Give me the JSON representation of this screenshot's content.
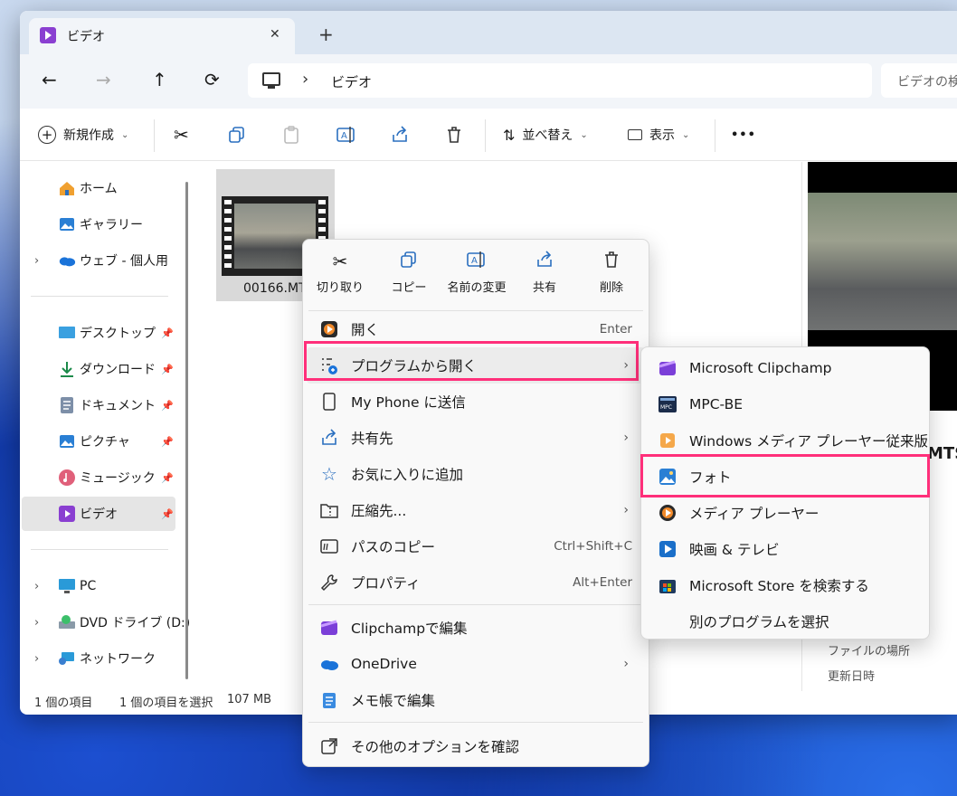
{
  "tab": {
    "title": "ビデオ",
    "close": "✕",
    "new_tab": "+"
  },
  "nav": {
    "back": "←",
    "forward": "→",
    "up": "↑",
    "refresh": "⟳",
    "chevron": "›",
    "location": "ビデオ",
    "search_placeholder": "ビデオの検"
  },
  "toolbar": {
    "new": "新規作成",
    "sort": "並べ替え",
    "view": "表示",
    "more": "•••"
  },
  "sidebar": {
    "home": "ホーム",
    "gallery": "ギャラリー",
    "web": "ウェブ - 個人用",
    "desktop": "デスクトップ",
    "downloads": "ダウンロード",
    "documents": "ドキュメント",
    "pictures": "ピクチャ",
    "music": "ミュージック",
    "videos": "ビデオ",
    "pc": "PC",
    "dvd": "DVD ドライブ (D:)",
    "network": "ネットワーク"
  },
  "file": {
    "name": "00166.MT"
  },
  "status": {
    "count": "1 個の項目",
    "selected": "1 個の項目を選択",
    "size": "107 MB"
  },
  "details": {
    "ext": "MTS",
    "location_label": "ファイルの場所",
    "modified_label": "更新日時"
  },
  "context_menu": {
    "quick": {
      "cut": "切り取り",
      "copy": "コピー",
      "rename": "名前の変更",
      "share": "共有",
      "delete": "削除"
    },
    "items": {
      "open": "開く",
      "open_shortcut": "Enter",
      "open_with": "プログラムから開く",
      "send_phone": "My Phone に送信",
      "share_to": "共有先",
      "favorites": "お気に入りに追加",
      "compress": "圧縮先...",
      "copy_path": "パスのコピー",
      "copy_path_shortcut": "Ctrl+Shift+C",
      "properties": "プロパティ",
      "properties_shortcut": "Alt+Enter",
      "clipchamp_edit": "Clipchampで編集",
      "onedrive": "OneDrive",
      "notepad": "メモ帳で編集",
      "more_options": "その他のオプションを確認"
    }
  },
  "submenu": {
    "clipchamp": "Microsoft Clipchamp",
    "mpcbe": "MPC-BE",
    "wmp_legacy": "Windows メディア プレーヤー従来版",
    "photos": "フォト",
    "media_player": "メディア プレーヤー",
    "movies_tv": "映画 & テレビ",
    "store": "Microsoft Store を検索する",
    "choose": "別のプログラムを選択"
  },
  "colors": {
    "highlight": "#ff2f7a",
    "accent": "#0067c0"
  }
}
